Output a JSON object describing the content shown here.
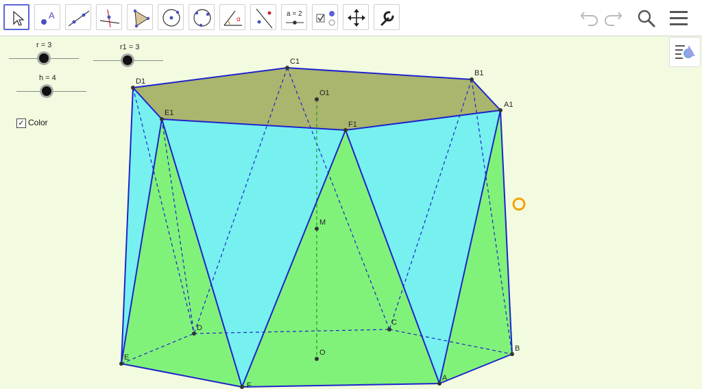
{
  "toolbar": {
    "tools": [
      {
        "name": "move-tool",
        "icon": "arrow-cursor-icon",
        "selected": true
      },
      {
        "name": "point-tool",
        "icon": "point-icon",
        "text": "A"
      },
      {
        "name": "line-tool",
        "icon": "line-through-points-icon"
      },
      {
        "name": "perpendicular-line-tool",
        "icon": "perpendicular-line-icon"
      },
      {
        "name": "polygon-tool",
        "icon": "polygon-icon"
      },
      {
        "name": "circle-center-point-tool",
        "icon": "circle-center-icon"
      },
      {
        "name": "circle-three-points-tool",
        "icon": "circle-three-points-icon"
      },
      {
        "name": "angle-tool",
        "icon": "angle-icon",
        "text": "α"
      },
      {
        "name": "reflect-line-tool",
        "icon": "reflect-icon"
      },
      {
        "name": "slider-tool",
        "icon": "slider-icon",
        "text": "a = 2"
      },
      {
        "name": "checkbox-tool",
        "icon": "checkbox-icon"
      },
      {
        "name": "move-view-tool",
        "icon": "move-graphics-view-icon"
      },
      {
        "name": "tools-wrench",
        "icon": "wrench-icon"
      }
    ],
    "right": [
      "undo-icon",
      "redo-icon",
      "search-icon",
      "menu-icon"
    ]
  },
  "sliders": [
    {
      "name": "r",
      "label": "r = 3"
    },
    {
      "name": "r1",
      "label": "r1 = 3"
    },
    {
      "name": "h",
      "label": "h = 4"
    }
  ],
  "checkbox": {
    "label": "Color",
    "checked": true
  },
  "points": [
    "A",
    "B",
    "C",
    "D",
    "E",
    "F",
    "A1",
    "B1",
    "C1",
    "D1",
    "E1",
    "F1",
    "O",
    "O1",
    "M"
  ],
  "colors": {
    "top_face": "#aab56e",
    "lateral_cyan": "#77f0f0",
    "lateral_green": "#80f27a",
    "edge": "#1e22cc",
    "axis": "#1a9d1a",
    "canvas": "#f2fbe0",
    "accent": "#f5a100"
  }
}
